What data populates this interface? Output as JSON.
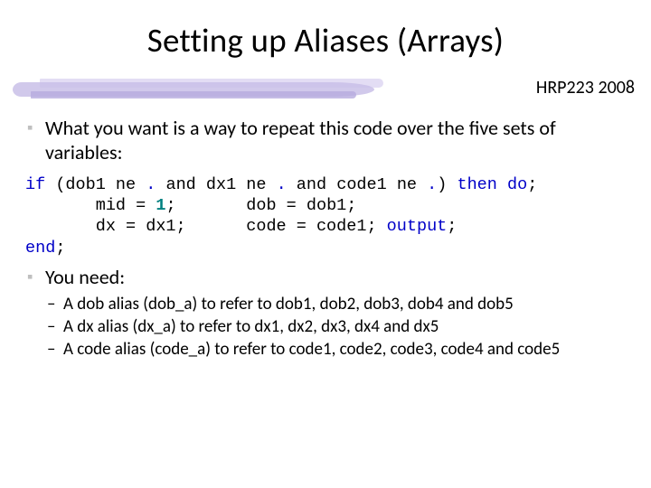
{
  "title": "Setting up Aliases (Arrays)",
  "course_tag": "HRP223 2008",
  "bullets": {
    "lead": "What you want is a way to repeat this code over the five sets of variables:",
    "need_label": "You need:",
    "need_items": [
      "A dob alias (dob_a) to refer to dob1, dob2, dob3, dob4 and dob5",
      "A dx alias (dx_a) to refer to dx1, dx2, dx3, dx4 and dx5",
      "A code alias (code_a) to refer to code1, code2, code3, code4 and code5"
    ]
  },
  "code": {
    "l1": {
      "t1": "if",
      "t2": " (dob1 ne ",
      "d1": ".",
      "t3": " and dx1 ne ",
      "d2": ".",
      "t4": " and code1 ne ",
      "d3": ".",
      "t5": ") ",
      "t6": "then do",
      "t7": ";"
    },
    "l2": {
      "pad": "       ",
      "a1": "mid = ",
      "n1": "1",
      "a2": ";       dob = dob1;"
    },
    "l3": {
      "pad": "       ",
      "a1": "dx = dx1;      code = code1; ",
      "out": "output",
      "a2": ";"
    },
    "l4": {
      "a1": "end",
      "a2": ";"
    }
  }
}
